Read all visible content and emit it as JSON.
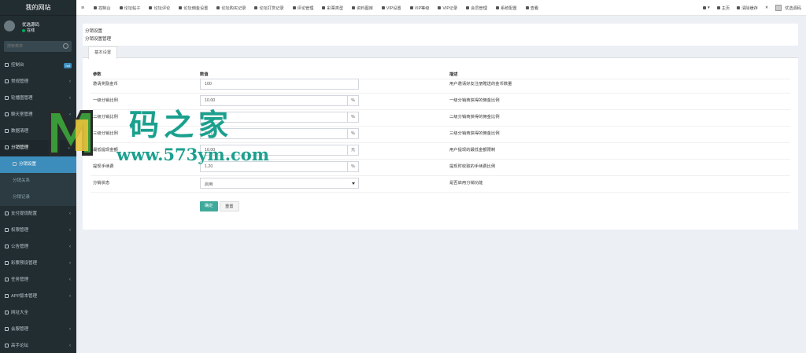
{
  "brand": {
    "title": "我的网站"
  },
  "user": {
    "name": "优选源码",
    "status": "在线"
  },
  "search": {
    "placeholder": "搜索菜单"
  },
  "sidebar": {
    "items": [
      {
        "label": "控制台",
        "badge": "hot",
        "icon": "dashboard-icon"
      },
      {
        "label": "常规管理",
        "icon": "cogs-icon"
      },
      {
        "label": "轮播图管理",
        "icon": "image-icon"
      },
      {
        "label": "聊天室管理",
        "icon": "chat-icon"
      },
      {
        "label": "数据清理",
        "icon": "trash-icon"
      },
      {
        "label": "分销管理",
        "icon": "share-icon"
      },
      {
        "label": "分销设置",
        "icon": "cog-icon",
        "active": true
      },
      {
        "label": "分销关系"
      },
      {
        "label": "分销记录"
      },
      {
        "label": "支付提现配置",
        "icon": "credit-card-icon"
      },
      {
        "label": "权限管理",
        "icon": "users-icon"
      },
      {
        "label": "公告管理",
        "icon": "bullhorn-icon"
      },
      {
        "label": "彩票预设管理",
        "icon": "ticket-icon"
      },
      {
        "label": "任务管理",
        "icon": "tasks-icon"
      },
      {
        "label": "APP版本管理",
        "icon": "mobile-icon"
      },
      {
        "label": "网址大全",
        "icon": "link-icon"
      },
      {
        "label": "会服管理",
        "icon": "user-icon"
      },
      {
        "label": "高手论坛",
        "icon": "forum-icon"
      }
    ]
  },
  "topbar": {
    "menu": [
      "控制台",
      "论坛帖子",
      "论坛评论",
      "论坛佣金设置",
      "论坛购买记录",
      "论坛打赏记录",
      "评论管理",
      "彩票类型",
      "资料图库",
      "VIP设置",
      "VIP等级",
      "VIP记录",
      "会员管理",
      "系统配置",
      "查看"
    ],
    "right": [
      "主页",
      "清除缓存",
      "优选源码"
    ]
  },
  "page": {
    "title": "分销设置",
    "subtitle": "分销设置管理",
    "tab": "基本设置",
    "columns": {
      "param": "参数",
      "value": "数值",
      "desc": "描述"
    }
  },
  "rows": [
    {
      "label": "邀请奖励金币",
      "value": "100",
      "suffix": "",
      "desc": "用户邀请好友注册赠送的金币数量"
    },
    {
      "label": "一级分销比例",
      "value": "10.00",
      "suffix": "%",
      "desc": "一级分销商获得的佣金比例"
    },
    {
      "label": "二级分销比例",
      "value": "",
      "suffix": "%",
      "desc": "二级分销商获得的佣金比例"
    },
    {
      "label": "三级分销比例",
      "value": "2.01",
      "suffix": "%",
      "desc": "三级分销商获得的佣金比例"
    },
    {
      "label": "最低提现金额",
      "value": "10.00",
      "suffix": "元",
      "desc": "用户提现的最低金额限制"
    },
    {
      "label": "提现手续费",
      "value": "1.20",
      "suffix": "%",
      "desc": "提现时收取的手续费比例"
    }
  ],
  "status_row": {
    "label": "分销状态",
    "value": "启用",
    "desc": "是否启用分销功能"
  },
  "buttons": {
    "ok": "确定",
    "reset": "重置"
  },
  "watermark": {
    "cn": "码之家",
    "url": "www.573ym.com"
  },
  "colors": {
    "sidebar": "#222d32",
    "active": "#3c8dbc",
    "accent": "#1ba08e"
  }
}
